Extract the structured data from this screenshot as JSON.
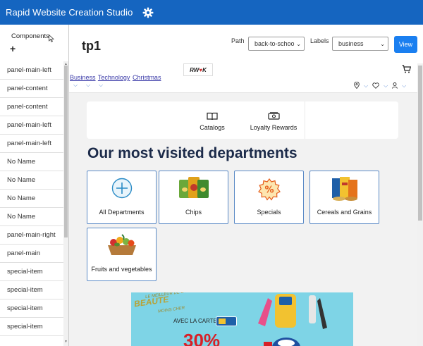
{
  "app": {
    "title": "Rapid Website Creation Studio",
    "gear_icon": "gear-icon"
  },
  "sidebar": {
    "header": "Components",
    "add_label": "+",
    "items": [
      {
        "label": "panel-main-left"
      },
      {
        "label": "panel-content"
      },
      {
        "label": "panel-content"
      },
      {
        "label": "panel-main-left"
      },
      {
        "label": "panel-main-left"
      },
      {
        "label": "No Name"
      },
      {
        "label": "No Name"
      },
      {
        "label": "No Name"
      },
      {
        "label": "No Name"
      },
      {
        "label": "panel-main-right"
      },
      {
        "label": "panel-main"
      },
      {
        "label": "special-item"
      },
      {
        "label": "special-item"
      },
      {
        "label": "special-item"
      },
      {
        "label": "special-item"
      }
    ]
  },
  "header": {
    "page_title": "tp1",
    "path_label": "Path",
    "path_value": "back-to-schoo",
    "labels_label": "Labels",
    "labels_value": "business",
    "view_button": "View"
  },
  "site": {
    "logo_text_a": "RW",
    "logo_text_b": "K",
    "nav_links": [
      "Business",
      "Technology",
      "Christmas"
    ],
    "loyalty_items": [
      {
        "label": "Catalogs",
        "icon": "book-icon"
      },
      {
        "label": "Loyalty Rewards",
        "icon": "cash-icon"
      }
    ],
    "section_title": "Our most visited departments",
    "departments": [
      {
        "label": "All Departments",
        "icon": "plus-circle-icon"
      },
      {
        "label": "Chips",
        "icon": "chips-icon"
      },
      {
        "label": "Specials",
        "icon": "percent-badge-icon"
      },
      {
        "label": "Cereals and Grains",
        "icon": "cereal-box-icon"
      },
      {
        "label": "Fruits and vegetables",
        "icon": "fruit-basket-icon"
      }
    ],
    "promo": {
      "line1": "LE MEILLEUR DE LA",
      "line2": "BEAUTE",
      "line3": "MOINS CHER",
      "carte": "AVEC LA CARTE",
      "big": "30%"
    }
  },
  "colors": {
    "topbar": "#1565c0",
    "accent_button": "#1a7ff0",
    "section_title": "#1c2b4a",
    "dept_border": "#5b8ac6"
  }
}
